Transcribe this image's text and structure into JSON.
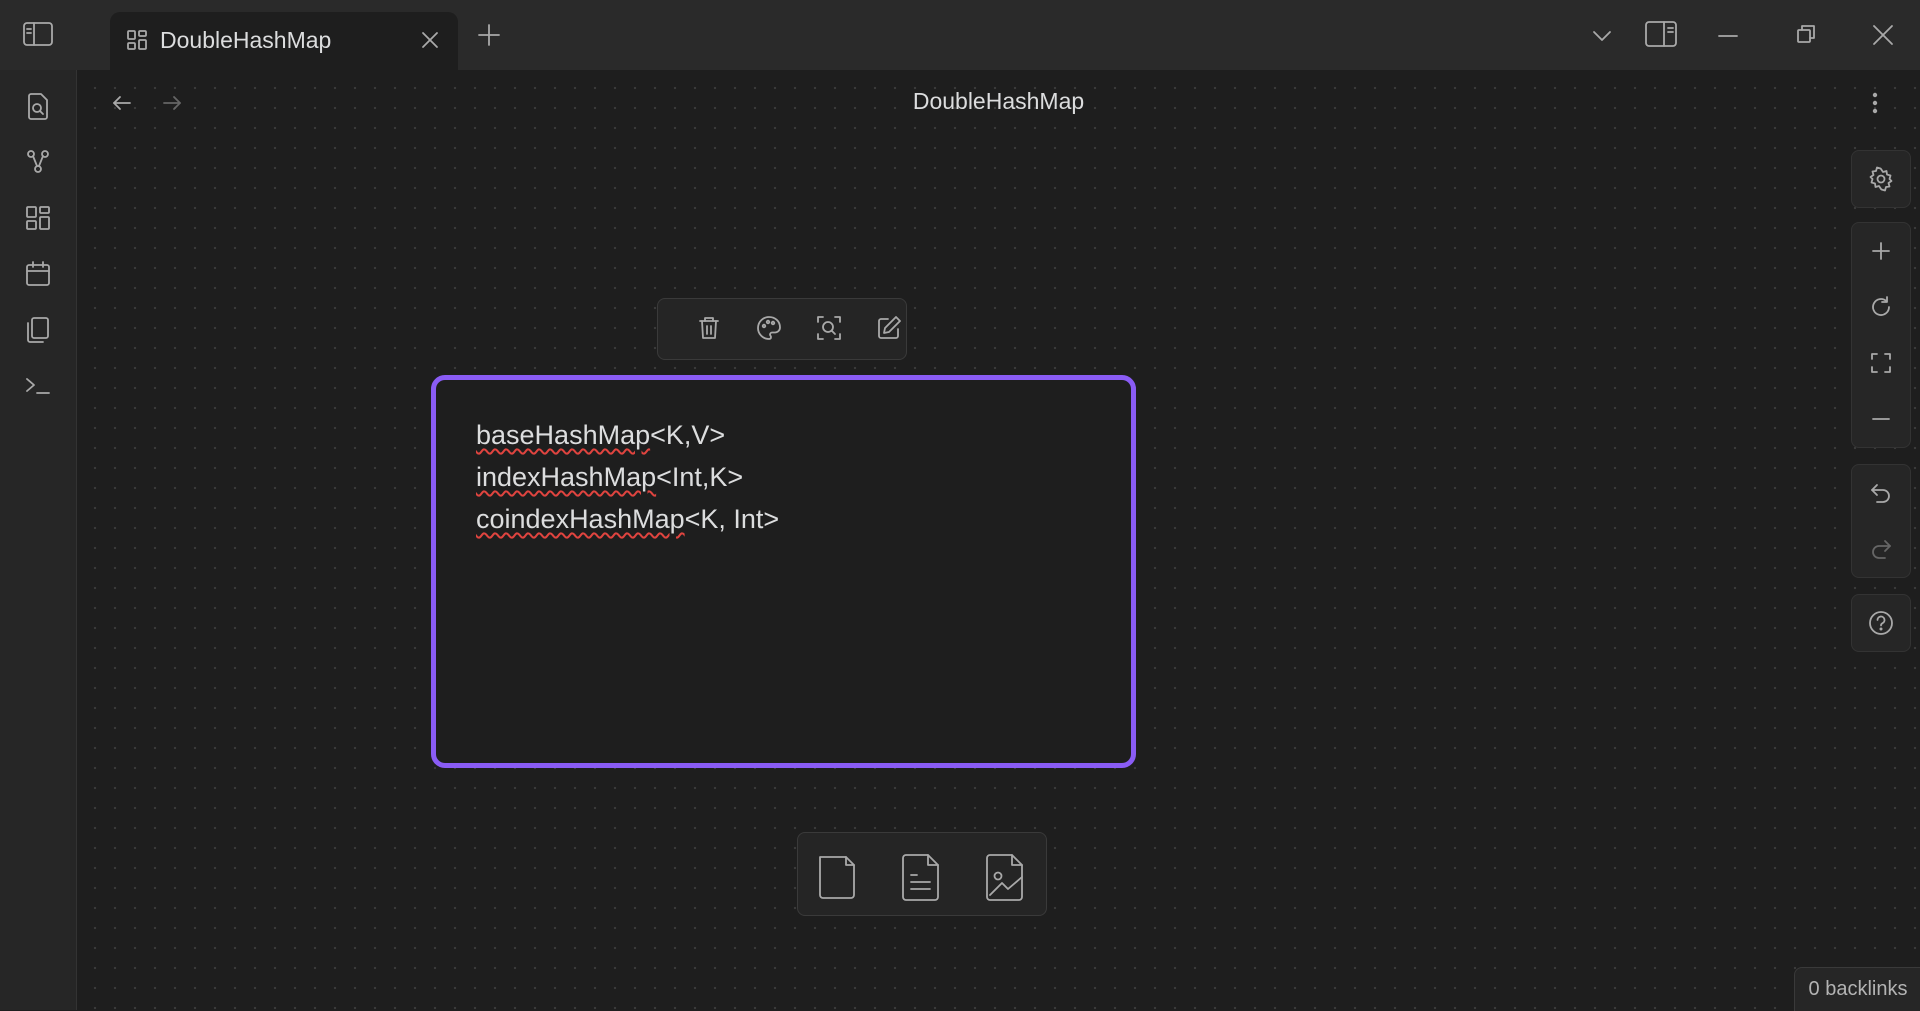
{
  "tab": {
    "title": "DoubleHashMap",
    "icon": "canvas-icon"
  },
  "header": {
    "title": "DoubleHashMap"
  },
  "ribbon": {
    "items": [
      {
        "name": "search-icon"
      },
      {
        "name": "graph-icon"
      },
      {
        "name": "canvas-icon"
      },
      {
        "name": "calendar-icon"
      },
      {
        "name": "templates-icon"
      },
      {
        "name": "terminal-icon"
      }
    ]
  },
  "node_menu": [
    "trash-icon",
    "palette-icon",
    "zoom-to-node-icon",
    "edit-icon"
  ],
  "card": {
    "lines": [
      {
        "word": "baseHashMap",
        "rest": "<K,V>"
      },
      {
        "word": "indexHashMap",
        "rest": "<Int,K>"
      },
      {
        "word": "coindexHashMap",
        "rest": "<K, Int>"
      }
    ],
    "border_color": "#8a5cf5"
  },
  "tray": [
    "card-icon",
    "note-icon",
    "media-icon"
  ],
  "status": {
    "backlinks": "0 backlinks"
  }
}
